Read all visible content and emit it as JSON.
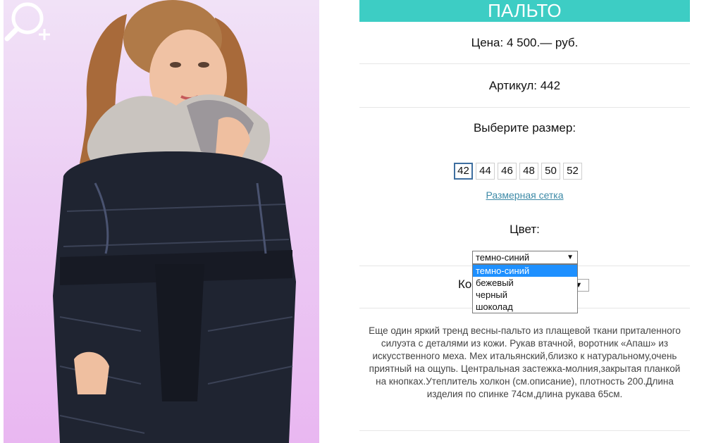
{
  "product": {
    "title": "ПАЛЬТО",
    "price": "Цена: 4 500.— руб.",
    "sku": "Артикул: 442",
    "size_title": "Выберите размер:",
    "sizes": [
      "42",
      "44",
      "46",
      "48",
      "50",
      "52"
    ],
    "selected_size": "42",
    "size_chart_link": "Размерная сетка",
    "color_title": "Цвет:",
    "color_selected": "темно-синий",
    "color_options": [
      "темно-синий",
      "бежевый",
      "черный",
      "шоколад"
    ],
    "quantity_label": "Ко",
    "description": "Еще один яркий тренд весны-пальто из плащевой ткани приталенного силуэта с деталями из кожи. Рукав втачной, воротник «Апаш» из искусственного меха. Мех итальянский,близко к натуральному,очень приятный на ощупь. Центральная застежка-молния,закрытая планкой на кнопках.Утеплитель холкон (см.описание), плотность 200.Длина изделия по спинке 74см,длина рукава 65см."
  },
  "colors": {
    "accent": "#3dcdc4",
    "link": "#3d8aa7",
    "dropdown_highlight": "#1e90ff"
  },
  "icons": {
    "zoom": "zoom-in-icon",
    "select_arrow": "dropdown-arrow-icon"
  }
}
